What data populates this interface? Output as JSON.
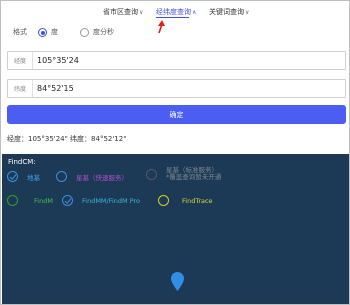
{
  "tabs": [
    {
      "label": "省市区查询"
    },
    {
      "label": "经纬度查询"
    },
    {
      "label": "关键词查询"
    }
  ],
  "format": {
    "label": "格式",
    "options": [
      "度",
      "度分秒"
    ],
    "selected": "度"
  },
  "longitude": {
    "label": "经度",
    "value": "105°35'24"
  },
  "latitude": {
    "label": "纬度",
    "value": "84°52'15"
  },
  "confirm_label": "确定",
  "result_text": "经度：105°35'24\"  纬度：84°52'12\"",
  "findcm": {
    "title": "FindCM:",
    "row1": [
      {
        "label": "地基",
        "checked": true
      },
      {
        "label": "星基（快速服务）",
        "checked": false
      },
      {
        "label_line1": "星基（标准服务）",
        "label_line2": "*覆盖查询暂未开通",
        "checked": false
      }
    ],
    "row2": [
      {
        "label": "FindM",
        "checked": false
      },
      {
        "label": "FindMM/FindM Pro",
        "checked": true
      },
      {
        "label": "FindTrace",
        "checked": false
      }
    ]
  },
  "colors": {
    "accent": "#4c5ef1",
    "map_bg": "#1c3a55",
    "annotation": "#e0201c"
  }
}
